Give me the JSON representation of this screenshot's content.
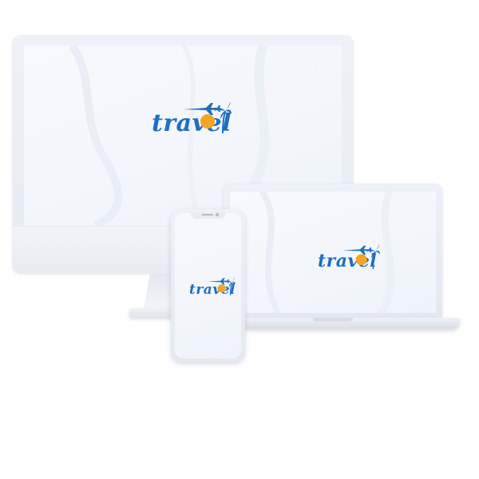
{
  "brand": {
    "wordmark": "travel",
    "primary_color": "#1e6fc1",
    "sun_color": "#f5a524",
    "plane_icon": "airplane-icon",
    "palm_icon": "palm-tree-icon",
    "sun_icon": "sun-icon"
  },
  "devices": {
    "monitor": {
      "logo_text": "travel"
    },
    "laptop": {
      "logo_text": "travel"
    },
    "phone": {
      "logo_text": "travel"
    }
  }
}
